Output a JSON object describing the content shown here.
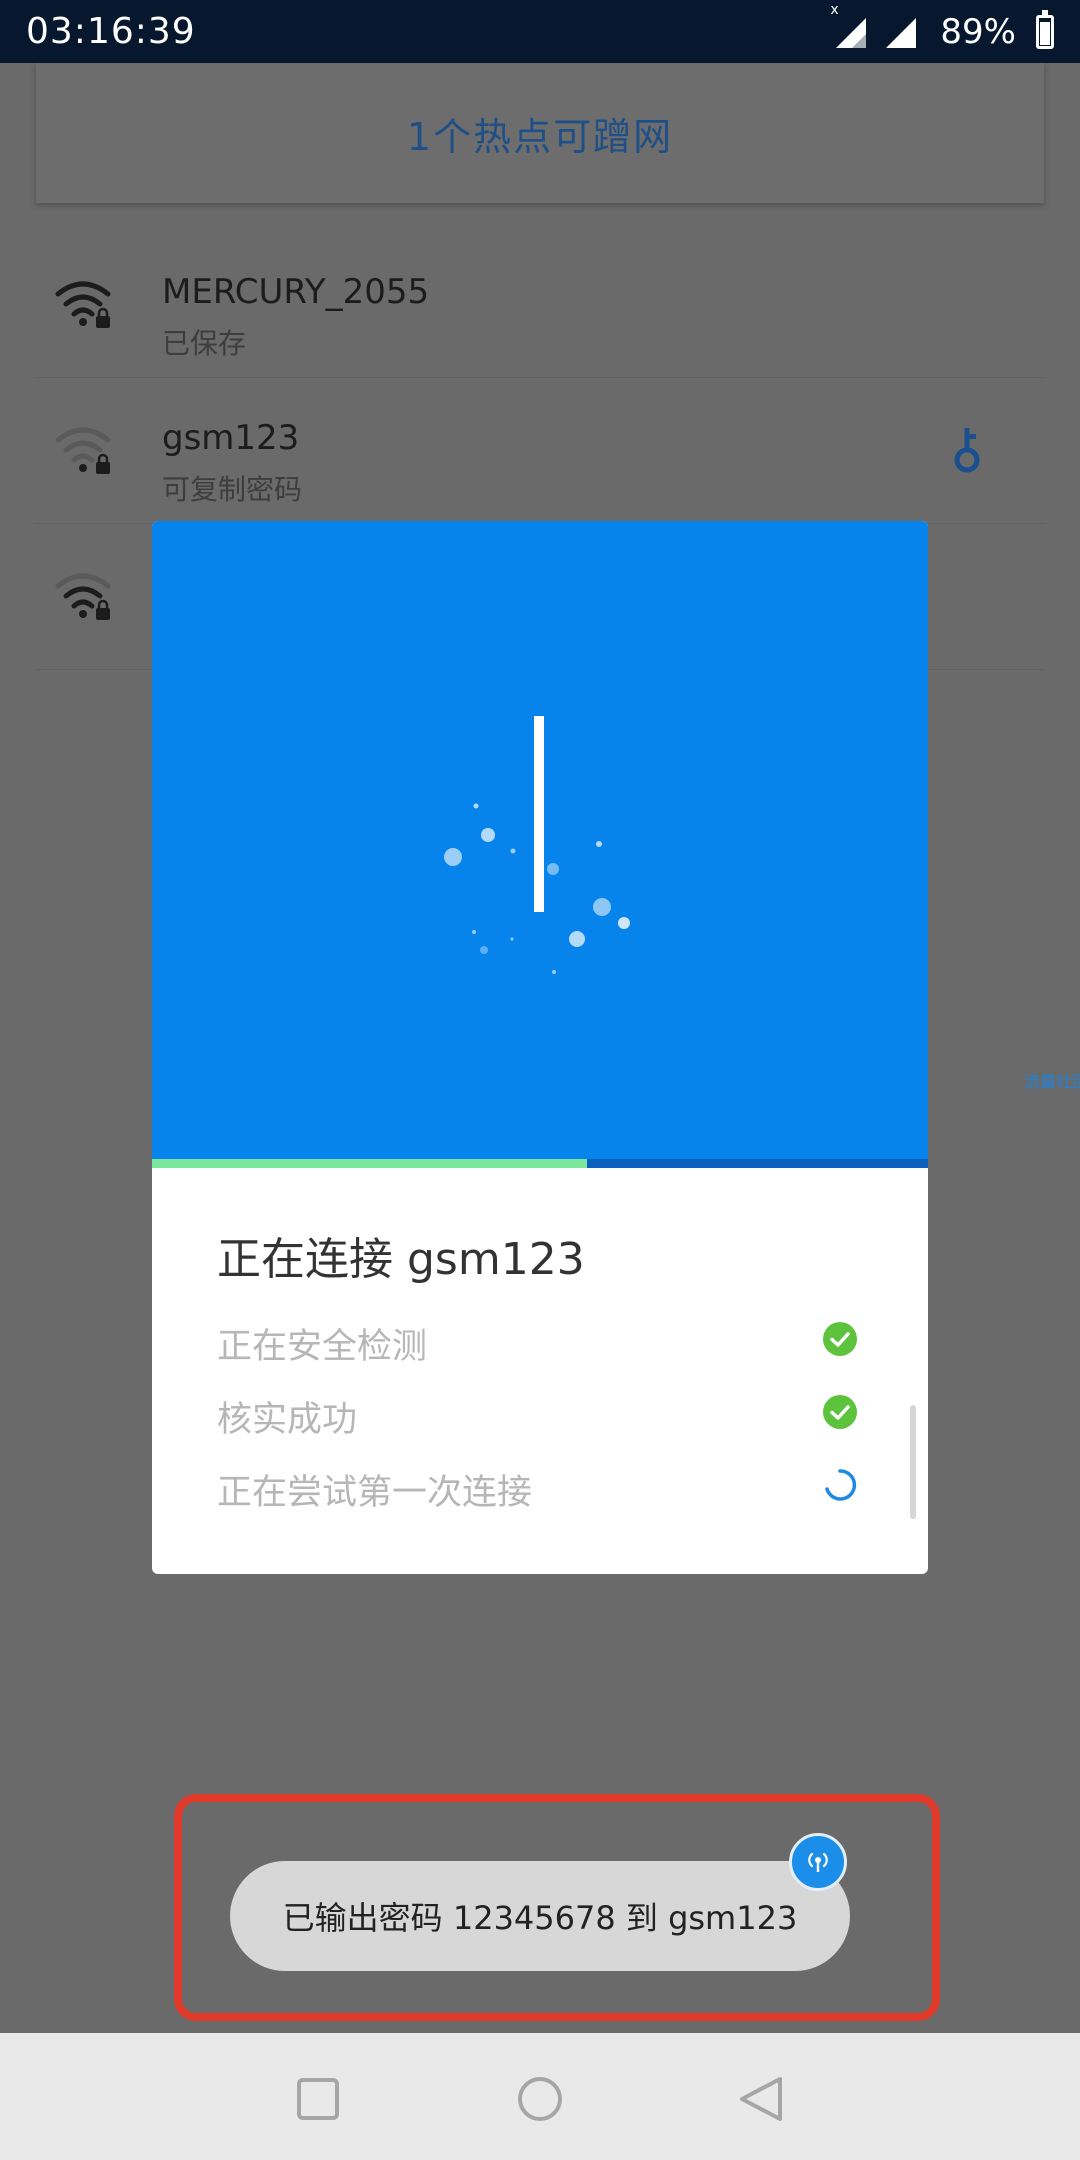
{
  "status_bar": {
    "time": "03:16:39",
    "no_sim_mark": "x",
    "battery": "89%",
    "battery_level": 0.89,
    "icons": [
      "signal-icon",
      "signal-icon",
      "battery-icon"
    ]
  },
  "header": {
    "title": "1个热点可蹭网"
  },
  "wifi_list": [
    {
      "ssid": "MERCURY_2055",
      "status": "已保存",
      "icon": "wifi-lock-icon"
    },
    {
      "ssid": "gsm123",
      "status": "可复制密码",
      "icon": "wifi-lock-icon",
      "action_icon": "key-icon"
    },
    {
      "ssid": "",
      "status": "",
      "icon": "wifi-lock-icon"
    }
  ],
  "side_link": "流量社区",
  "dialog": {
    "title": "正在连接 gsm123",
    "progress": 0.56,
    "colors": {
      "hero": "#0684ec",
      "progress": "#7ce69a",
      "check": "#5dc33d",
      "spinner": "#1e88e5"
    },
    "steps": [
      {
        "label": "正在安全检测",
        "state": "done",
        "icon": "check-circle-icon"
      },
      {
        "label": "核实成功",
        "state": "done",
        "icon": "check-circle-icon"
      },
      {
        "label": "正在尝试第一次连接",
        "state": "loading",
        "icon": "spinner-icon"
      }
    ]
  },
  "toast": {
    "text": "已输出密码 12345678 到 gsm123",
    "badge_icon": "hotspot-icon",
    "highlight_color": "#e03a2b"
  },
  "nav_bar": {
    "buttons": [
      "recent-apps-icon",
      "home-icon",
      "back-icon"
    ]
  }
}
